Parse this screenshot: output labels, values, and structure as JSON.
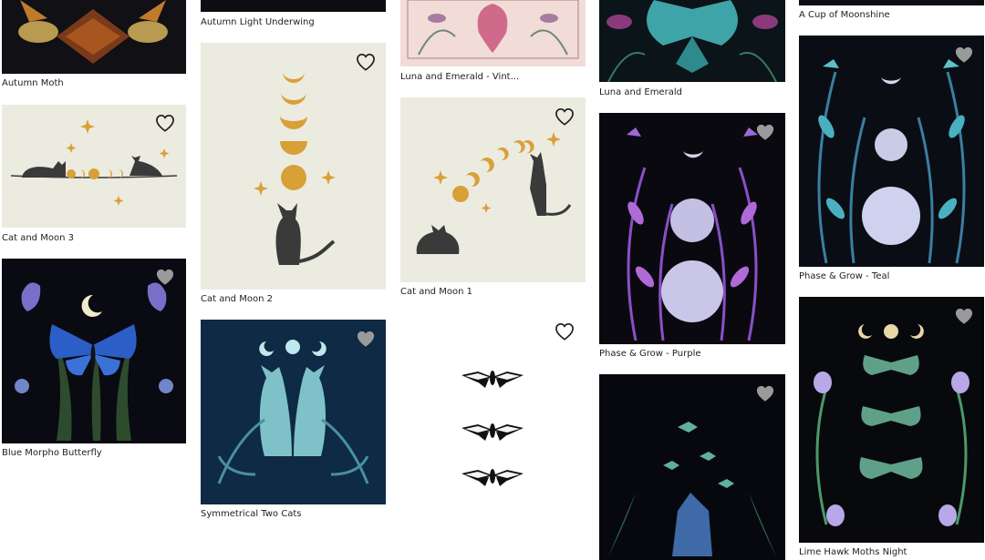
{
  "gallery": {
    "items": [
      {
        "title": "Autumn Moth"
      },
      {
        "title": "Cat and Moon 3"
      },
      {
        "title": "Blue Morpho Butterfly"
      },
      {
        "title": "Autumn Light Underwing"
      },
      {
        "title": "Cat and Moon 2"
      },
      {
        "title": "Symmetrical Two Cats"
      },
      {
        "title": "Luna and Emerald - Vint..."
      },
      {
        "title": "Cat and Moon 1"
      },
      {
        "title": "Luna and Emerald"
      },
      {
        "title": "Phase & Grow - Purple"
      },
      {
        "title": "A Cup of Moonshine"
      },
      {
        "title": "Phase & Grow - Teal"
      },
      {
        "title": "Lime Hawk Moths Night"
      }
    ]
  },
  "icons": {
    "favorite": "heart-icon"
  },
  "colors": {
    "gold": "#d9a038",
    "cream": "#ecebe0",
    "dark": "#0c0c12",
    "cat": "#3a3a3a"
  }
}
